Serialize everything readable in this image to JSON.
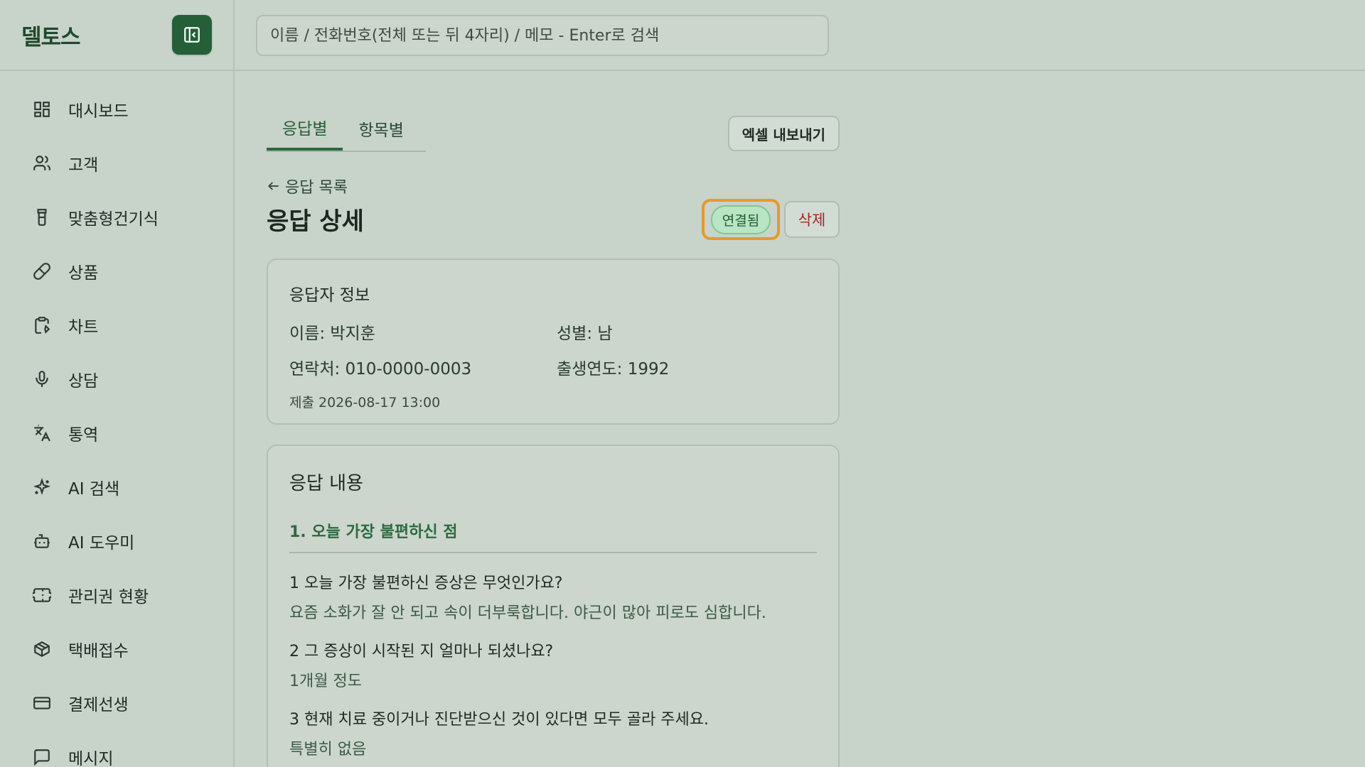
{
  "app": {
    "logo": "델토스"
  },
  "search": {
    "placeholder": "이름 / 전화번호(전체 또는 뒤 4자리) / 메모 - Enter로 검색"
  },
  "sidebar": {
    "items": [
      {
        "label": "대시보드",
        "icon": "dashboard-icon"
      },
      {
        "label": "고객",
        "icon": "users-icon"
      },
      {
        "label": "맞춤형건기식",
        "icon": "bottle-icon"
      },
      {
        "label": "상품",
        "icon": "pill-icon"
      },
      {
        "label": "차트",
        "icon": "clipboard-icon"
      },
      {
        "label": "상담",
        "icon": "mic-icon"
      },
      {
        "label": "통역",
        "icon": "translate-icon"
      },
      {
        "label": "AI 검색",
        "icon": "sparkles-icon"
      },
      {
        "label": "AI 도우미",
        "icon": "bot-icon"
      },
      {
        "label": "관리권 현황",
        "icon": "ticket-icon"
      },
      {
        "label": "택배접수",
        "icon": "package-icon"
      },
      {
        "label": "결제선생",
        "icon": "card-icon"
      },
      {
        "label": "메시지",
        "icon": "message-icon"
      }
    ]
  },
  "tabs": [
    {
      "label": "응답별",
      "active": true
    },
    {
      "label": "항목별",
      "active": false
    }
  ],
  "toolbar": {
    "export_label": "엑셀 내보내기"
  },
  "page": {
    "back_label": "응답 목록",
    "title": "응답 상세",
    "status_label": "연결됨",
    "delete_label": "삭제"
  },
  "respondent": {
    "section_title": "응답자 정보",
    "name": "이름: 박지훈",
    "gender": "성별: 남",
    "phone": "연락처: 010-0000-0003",
    "birth_year": "출생연도: 1992",
    "submitted": "제출 2026-08-17 13:00"
  },
  "responses": {
    "title": "응답 내용",
    "section_title": "1. 오늘 가장 불편하신 점",
    "items": [
      {
        "q": "1  오늘 가장 불편하신 증상은 무엇인가요?",
        "a": "요즘 소화가 잘 안 되고 속이 더부룩합니다. 야근이 많아 피로도 심합니다."
      },
      {
        "q": "2  그 증상이 시작된 지 얼마나 되셨나요?",
        "a": "1개월 정도"
      },
      {
        "q": "3  현재 치료 중이거나 진단받으신 것이 있다면 모두 골라 주세요.",
        "a": "특별히 없음"
      }
    ]
  },
  "colors": {
    "accent": "#245f37",
    "highlight": "#e49a2e",
    "danger": "#9c2a22"
  }
}
